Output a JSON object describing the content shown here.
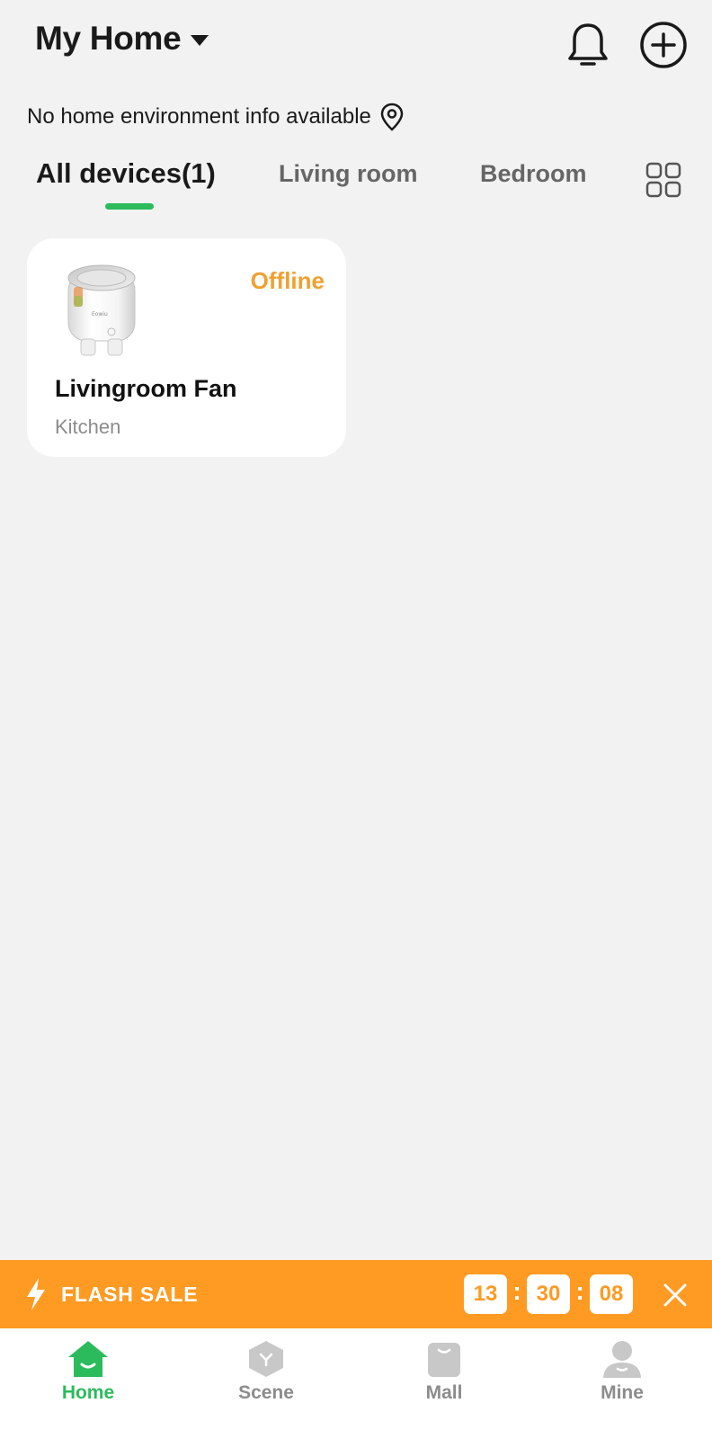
{
  "header": {
    "home_name": "My Home",
    "icons": {
      "caret": "caret-down-icon",
      "bell": "bell-icon",
      "add": "plus-circle-icon"
    }
  },
  "environment": {
    "text": "No home environment info available",
    "icon": "location-pin-icon"
  },
  "tabs": [
    {
      "label": "All devices(1)",
      "active": true
    },
    {
      "label": "Living room",
      "active": false
    },
    {
      "label": "Bedroom",
      "active": false
    }
  ],
  "grid_icon": "grid-view-icon",
  "devices": [
    {
      "name": "Livingroom Fan",
      "room": "Kitchen",
      "status": "Offline",
      "image": "smart-plug-image"
    }
  ],
  "flash_sale": {
    "label": "FLASH SALE",
    "timer": {
      "hours": "13",
      "minutes": "30",
      "seconds": "08"
    },
    "icons": {
      "bolt": "lightning-bolt-icon",
      "close": "close-icon"
    }
  },
  "bottom_nav": [
    {
      "label": "Home",
      "icon": "home-icon",
      "active": true
    },
    {
      "label": "Scene",
      "icon": "scene-icon",
      "active": false
    },
    {
      "label": "Mall",
      "icon": "shopping-bag-icon",
      "active": false
    },
    {
      "label": "Mine",
      "icon": "person-icon",
      "active": false
    }
  ],
  "colors": {
    "accent_green": "#2bbb5c",
    "offline_orange": "#f0a030",
    "flash_orange": "#ff9a22",
    "background": "#f2f2f2",
    "inactive_gray": "#8c8c8c"
  }
}
